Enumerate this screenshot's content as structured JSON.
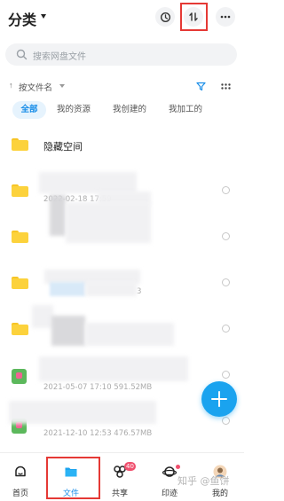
{
  "header": {
    "title": "分类",
    "history_icon": "history-icon",
    "sort_icon": "sort-icon",
    "more_icon": "more-icon"
  },
  "search": {
    "placeholder": "搜索网盘文件"
  },
  "sort_bar": {
    "label": "按文件名",
    "arrow": "↑",
    "filter_icon": "filter-icon",
    "view_icon": "grid-view-icon"
  },
  "tabs": [
    {
      "label": "全部",
      "active": true
    },
    {
      "label": "我的资源",
      "active": false
    },
    {
      "label": "我创建的",
      "active": false
    },
    {
      "label": "我加工的",
      "active": false
    }
  ],
  "files": [
    {
      "name": "隐藏空间",
      "meta": ""
    },
    {
      "name": "",
      "meta": "2022-02-18  17:59"
    },
    {
      "name": "",
      "meta": ""
    },
    {
      "name": "",
      "meta": "3"
    },
    {
      "name": "",
      "meta": ""
    },
    {
      "name": "",
      "meta": "2021-05-07  17:10   591.52MB"
    },
    {
      "name": "",
      "meta": "2021-12-10  12:53   476.57MB"
    }
  ],
  "fab": {
    "icon": "plus-icon"
  },
  "bottom_nav": [
    {
      "label": "首页",
      "icon": "home-icon",
      "active": false,
      "badge": ""
    },
    {
      "label": "文件",
      "icon": "folder-icon",
      "active": true,
      "badge": ""
    },
    {
      "label": "共享",
      "icon": "share-icon",
      "active": false,
      "badge": "40"
    },
    {
      "label": "印迹",
      "icon": "planet-icon",
      "active": false,
      "badge": ""
    },
    {
      "label": "我的",
      "icon": "avatar-icon",
      "active": false,
      "badge": ""
    }
  ],
  "watermark": "知乎 @鱼饼",
  "colors": {
    "accent": "#1a8ee8",
    "fab": "#1aa3ef",
    "folder": "#fcd23c",
    "highlight": "#e53935",
    "badge": "#f0506e"
  }
}
